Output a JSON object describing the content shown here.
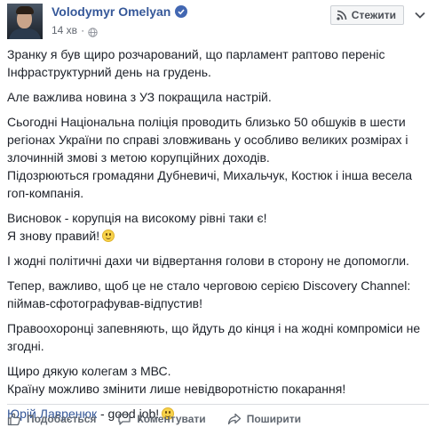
{
  "post": {
    "author": "Volodymyr Omelyan",
    "time": "14 хв",
    "separator": "·",
    "follow_label": "Стежити",
    "paragraphs": [
      [
        "Зранку я був щиро розчарований, що парламент раптово переніс",
        "Інфраструктурний день на грудень."
      ],
      [
        "Але важлива новина з УЗ покращила настрій."
      ],
      [
        "Сьогодні Національна поліція проводить близько 50 обшуків в шести",
        "регіонах України по справі зловживань у особливо великих розмірах і",
        "злочинній змові з метою корупційних доходів.",
        "Підозрюються громадяни Дубневичі, Михальчук, Костюк і інша весела",
        "гоп-компанія."
      ],
      [
        "Висновок - корупція на високому рівні таки є!",
        "Я знову правий!"
      ],
      [
        "І жодні політичні дахи чи відвертання голови в сторону не допомогли."
      ],
      [
        "Тепер, важливо, щоб це не стало черговою серією Discovery Channel:",
        "піймав-сфотографував-відпустив!"
      ],
      [
        "Правоохоронці запевняють, що йдуть до кінця і на жодні компроміси не",
        "згодні."
      ],
      [
        "Щиро дякую колегам з МВС.",
        "Країну можливо змінити лише невідворотністю покарання!"
      ]
    ],
    "last_line": {
      "mention": "Юрій Лавренюк",
      "text": " - good job!"
    }
  },
  "actions": {
    "like": "Подобається",
    "comment": "Коментувати",
    "share": "Поширити"
  },
  "icons": {
    "verified": "verified-badge-icon",
    "privacy": "globe-icon",
    "follow": "rss-feed-icon",
    "menu": "chevron-down-icon",
    "emoji": "smile-emoji-icon",
    "like": "thumbs-up-icon",
    "comment": "speech-bubble-icon",
    "share": "share-arrow-icon"
  },
  "colors": {
    "link": "#365899",
    "text": "#1d2129",
    "muted": "#616770",
    "verified": "#4267b2"
  }
}
